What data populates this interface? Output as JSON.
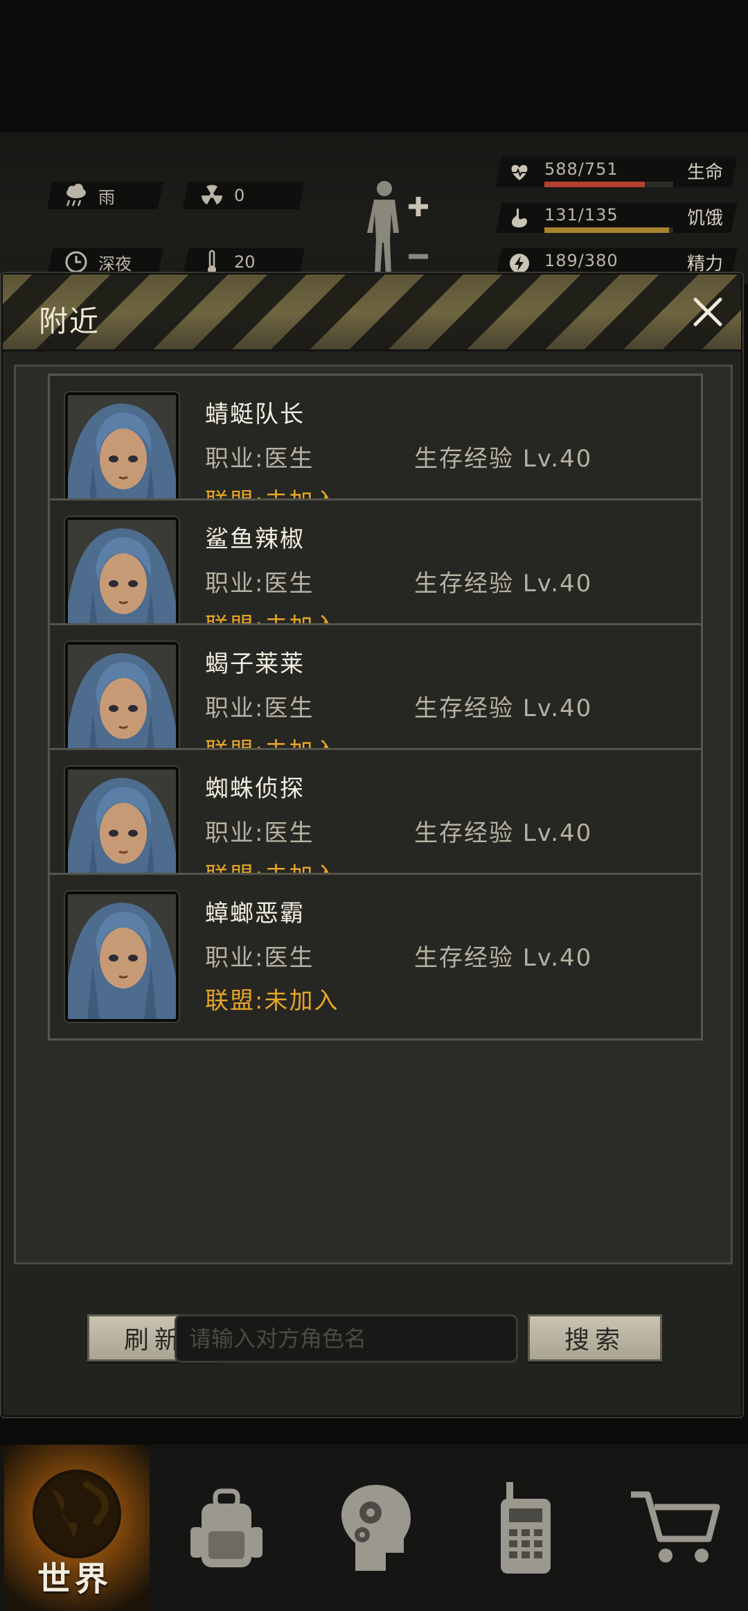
{
  "hud": {
    "weather": "雨",
    "radiation": "0",
    "time_of_day": "深夜",
    "temperature": "20",
    "stats": [
      {
        "value": "588/751",
        "label": "生命",
        "fill": 0.78,
        "color": "#b5402f"
      },
      {
        "value": "131/135",
        "label": "饥饿",
        "fill": 0.97,
        "color": "#a8822f"
      },
      {
        "value": "189/380",
        "label": "精力",
        "fill": 0.5,
        "color": "#6c6a5e"
      }
    ]
  },
  "panel": {
    "title": "附近",
    "players": [
      {
        "name": "蜻蜓队长",
        "job": "职业:医生",
        "exp": "生存经验 Lv.40",
        "alliance": "联盟:未加入"
      },
      {
        "name": "鲨鱼辣椒",
        "job": "职业:医生",
        "exp": "生存经验 Lv.40",
        "alliance": "联盟:未加入"
      },
      {
        "name": "蝎子莱莱",
        "job": "职业:医生",
        "exp": "生存经验 Lv.40",
        "alliance": "联盟:未加入"
      },
      {
        "name": "蜘蛛侦探",
        "job": "职业:医生",
        "exp": "生存经验 Lv.40",
        "alliance": "联盟:未加入"
      },
      {
        "name": "蟑螂恶霸",
        "job": "职业:医生",
        "exp": "生存经验 Lv.40",
        "alliance": "联盟:未加入"
      }
    ],
    "refresh_label": "刷新",
    "search_placeholder": "请输入对方角色名",
    "search_label": "搜索"
  },
  "nav": {
    "active_label": "世界",
    "icons": [
      "globe-icon",
      "backpack-icon",
      "brain-icon",
      "radio-icon",
      "cart-icon"
    ]
  }
}
